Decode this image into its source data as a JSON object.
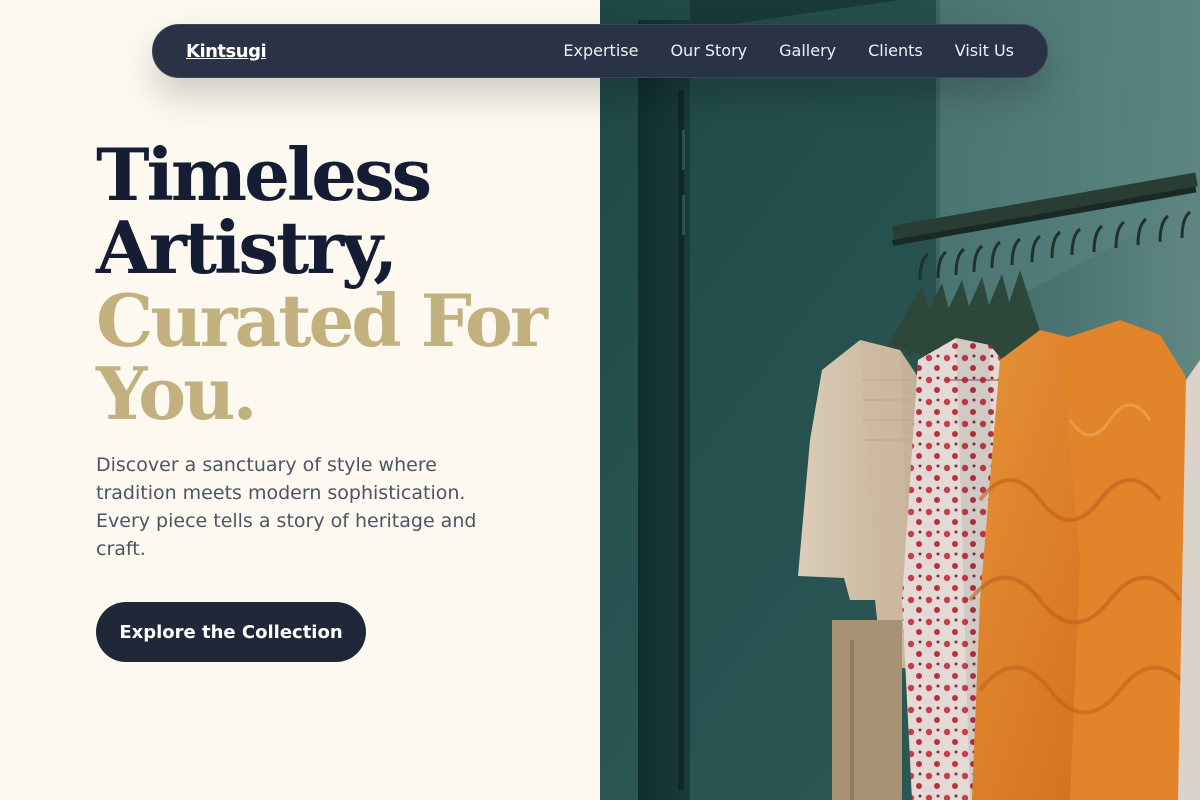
{
  "navbar": {
    "brand": "Kintsugi",
    "links": [
      {
        "label": "Expertise"
      },
      {
        "label": "Our Story"
      },
      {
        "label": "Gallery"
      },
      {
        "label": "Clients"
      },
      {
        "label": "Visit Us"
      }
    ]
  },
  "hero": {
    "headline": {
      "line1": "Timeless",
      "line2": "Artistry,",
      "line3": "Curated For",
      "line4": "You."
    },
    "description": "Discover a sanctuary of style where tradition meets modern sophistication. Every piece tells a story of heritage and craft.",
    "cta_label": "Explore the Collection",
    "image_alt": "clothing rack with cream, floral and orange garments"
  },
  "colors": {
    "background": "#fdf9f0",
    "navy": "#141d33",
    "gold": "#c3b07f",
    "navbar": "#2a3346",
    "button": "#1f2738",
    "body_text": "#4b5564"
  }
}
